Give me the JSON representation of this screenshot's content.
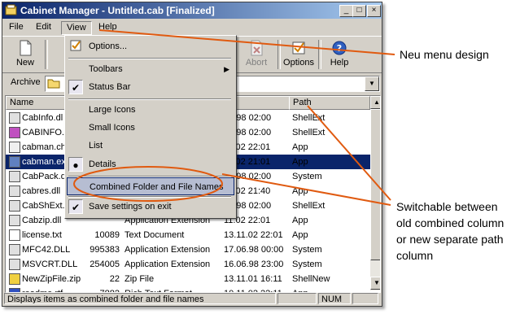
{
  "window": {
    "title": "Cabinet Manager - Untitled.cab [Finalized]"
  },
  "menubar": [
    {
      "label": "File"
    },
    {
      "label": "Edit"
    },
    {
      "label": "View"
    },
    {
      "label": "Help"
    }
  ],
  "toolbar": {
    "new": "New",
    "abort": "Abort",
    "options": "Options",
    "help": "Help"
  },
  "archive": {
    "label": "Archive"
  },
  "columns": {
    "name": "Name",
    "size": "",
    "type": "",
    "modified": "dified",
    "path": "Path"
  },
  "files": [
    {
      "name": "CabInfo.dl",
      "size": "",
      "type": "",
      "modified": "08.98 02:00",
      "path": "ShellExt"
    },
    {
      "name": "CABINFO.I",
      "size": "",
      "type": "",
      "modified": "08.98 02:00",
      "path": "ShellExt"
    },
    {
      "name": "cabman.ch",
      "size": "",
      "type": "",
      "modified": "11.02 22:01",
      "path": "App"
    },
    {
      "name": "cabman.ex",
      "size": "",
      "type": "",
      "modified": "11.02 21:01",
      "path": "App"
    },
    {
      "name": "CabPack.d",
      "size": "",
      "type": "",
      "modified": "08.98 02:00",
      "path": "System"
    },
    {
      "name": "cabres.dll",
      "size": "",
      "type": "",
      "modified": "11.02 21:40",
      "path": "App"
    },
    {
      "name": "CabShExt.",
      "size": "",
      "type": "",
      "modified": "08.98 02:00",
      "path": "ShellExt"
    },
    {
      "name": "Cabzip.dll",
      "size": "",
      "type": "Application Extension",
      "modified": "11.02 22:01",
      "path": "App"
    },
    {
      "name": "license.txt",
      "size": "10089",
      "type": "Text Document",
      "modified": "13.11.02 22:01",
      "path": "App"
    },
    {
      "name": "MFC42.DLL",
      "size": "995383",
      "type": "Application Extension",
      "modified": "17.06.98 00:00",
      "path": "System"
    },
    {
      "name": "MSVCRT.DLL",
      "size": "254005",
      "type": "Application Extension",
      "modified": "16.06.98 23:00",
      "path": "System"
    },
    {
      "name": "NewZipFile.zip",
      "size": "22",
      "type": "Zip File",
      "modified": "13.11.01 16:11",
      "path": "ShellNew"
    },
    {
      "name": "readme.rtf",
      "size": "7882",
      "type": "Rich Text Format",
      "modified": "10.11.02 22:11",
      "path": "App"
    }
  ],
  "view_menu": {
    "options": "Options...",
    "toolbars": "Toolbars",
    "status_bar": "Status Bar",
    "large_icons": "Large Icons",
    "small_icons": "Small Icons",
    "list": "List",
    "details": "Details",
    "combined": "Combined Folder and File Names",
    "save_settings": "Save settings on exit"
  },
  "statusbar": {
    "message": "Displays items as combined folder and file names",
    "num": "NUM"
  },
  "annotations": {
    "menu_note": "Neu menu design",
    "switch_note_1": "Switchable between",
    "switch_note_2": "old combined column",
    "switch_note_3": "or new separate path",
    "switch_note_4": "column"
  },
  "colors": {
    "accent": "#e05a10",
    "title_start": "#0a246a",
    "menu_highlight": "#b6bdd2"
  }
}
